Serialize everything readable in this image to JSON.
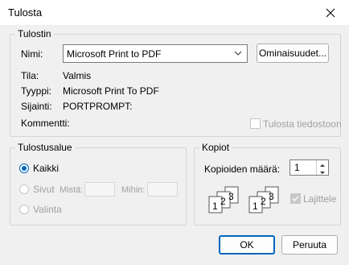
{
  "window": {
    "title": "Tulosta"
  },
  "printer": {
    "group_label": "Tulostin",
    "name_label": "Nimi:",
    "name_value": "Microsoft Print to PDF",
    "properties_button": "Ominaisuudet...",
    "status_label": "Tila:",
    "status_value": "Valmis",
    "type_label": "Tyyppi:",
    "type_value": "Microsoft Print To PDF",
    "where_label": "Sijainti:",
    "where_value": "PORTPROMPT:",
    "comment_label": "Kommentti:",
    "print_to_file_label": "Tulosta tiedostoon"
  },
  "range": {
    "group_label": "Tulostusalue",
    "all_label": "Kaikki",
    "pages_label": "Sivut",
    "from_label": "Mistä:",
    "to_label": "Mihin:",
    "selection_label": "Valinta"
  },
  "copies": {
    "group_label": "Kopiot",
    "count_label": "Kopioiden määrä:",
    "count_value": "1",
    "collate_label": "Lajittele",
    "page_numbers": [
      "1",
      "2",
      "3"
    ]
  },
  "buttons": {
    "ok": "OK",
    "cancel": "Peruuta"
  },
  "colors": {
    "accent": "#0067c0",
    "background": "#f0f0f0"
  }
}
